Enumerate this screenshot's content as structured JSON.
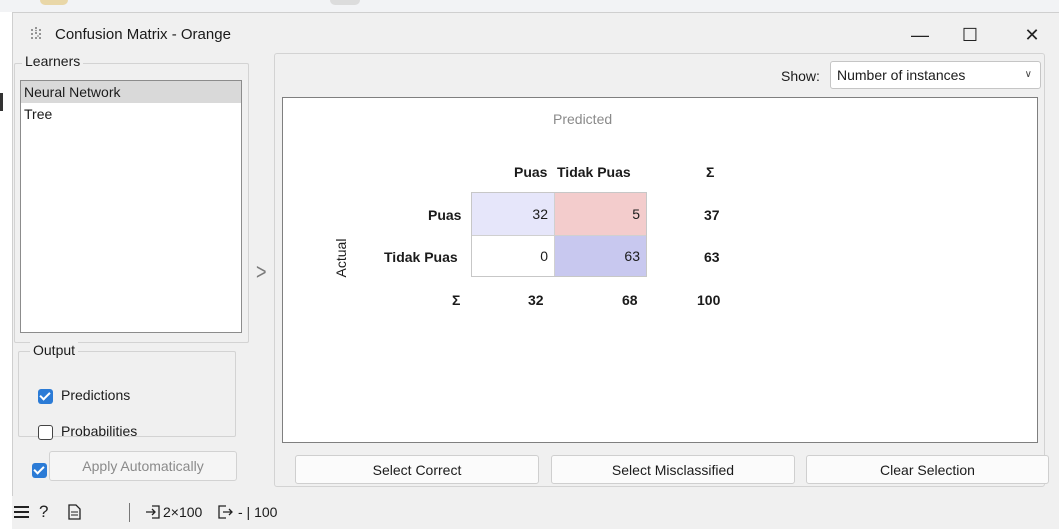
{
  "window": {
    "title": "Confusion Matrix - Orange",
    "controls": {
      "minimize": "—",
      "maximize": "☐",
      "close": "✕"
    }
  },
  "learners": {
    "label": "Learners",
    "items": [
      "Neural Network",
      "Tree"
    ],
    "selected_index": 0
  },
  "output": {
    "label": "Output",
    "predictions": {
      "label": "Predictions",
      "checked": true
    },
    "probabilities": {
      "label": "Probabilities",
      "checked": false
    }
  },
  "apply": {
    "label": "Apply Automatically",
    "checked": true
  },
  "show": {
    "label": "Show:",
    "value": "Number of instances"
  },
  "matrix": {
    "predicted_label": "Predicted",
    "actual_label": "Actual",
    "sum_symbol": "Σ",
    "classes": [
      "Puas",
      "Tidak Puas"
    ],
    "cells": [
      [
        "32",
        "5"
      ],
      [
        "0",
        "63"
      ]
    ],
    "row_sums": [
      "37",
      "63"
    ],
    "col_sums": [
      "32",
      "68"
    ],
    "total": "100",
    "colors": {
      "correct_light": "#e6e6fa",
      "correct_strong": "#c8c8ef",
      "wrong_light": "#f3cccc",
      "wrong_none": "#ffffff"
    }
  },
  "buttons": {
    "select_correct": "Select Correct",
    "select_misclassified": "Select Misclassified",
    "clear_selection": "Clear Selection"
  },
  "statusbar": {
    "input_summary": "2×100",
    "output_summary": "- | 100"
  }
}
